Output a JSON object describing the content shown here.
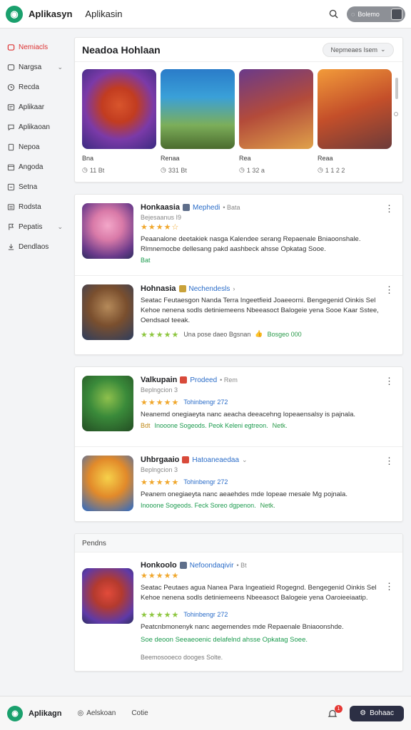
{
  "topbar": {
    "app_name": "Aplikasyn",
    "app_sub": "Aplikasin",
    "search_icon": "search-icon",
    "user_label": "Bolemo"
  },
  "sidebar": {
    "items": [
      {
        "label": "Nemiacls",
        "icon": "home-icon",
        "active": true,
        "chevron": false
      },
      {
        "label": "Nargsa",
        "icon": "grid-icon",
        "active": false,
        "chevron": true
      },
      {
        "label": "Recda",
        "icon": "clock-icon",
        "active": false,
        "chevron": false
      },
      {
        "label": "Aplikaar",
        "icon": "tag-icon",
        "active": false,
        "chevron": false
      },
      {
        "label": "Aplikaoan",
        "icon": "chat-icon",
        "active": false,
        "chevron": false
      },
      {
        "label": "Nepoa",
        "icon": "doc-icon",
        "active": false,
        "chevron": false
      },
      {
        "label": "Angoda",
        "icon": "calendar-icon",
        "active": false,
        "chevron": false
      },
      {
        "label": "Setna",
        "icon": "settings-icon",
        "active": false,
        "chevron": false
      },
      {
        "label": "Rodsta",
        "icon": "list-icon",
        "active": false,
        "chevron": false
      },
      {
        "label": "Pepatis",
        "icon": "flag-icon",
        "active": false,
        "chevron": true
      },
      {
        "label": "Dendlaos",
        "icon": "download-icon",
        "active": false,
        "chevron": false
      }
    ]
  },
  "featured": {
    "title": "Neadoa Hohlaan",
    "filter_label": "Nepmeaes Isem",
    "items": [
      {
        "name": "Bna",
        "meta": "11 Bt"
      },
      {
        "name": "Renaa",
        "meta": "331 Bt"
      },
      {
        "name": "Rea",
        "meta": "1 32 a"
      },
      {
        "name": "Reaa",
        "meta": "1 1 2 2"
      }
    ]
  },
  "apps_group1": [
    {
      "title": "Honkaasia",
      "developer": "Mephedi",
      "dev_suffix": "• Bata",
      "subline": "Bejesaanus I9",
      "stars": "★★★★☆",
      "rating_text": "",
      "desc": "Peaanalone deetakiek nasga Kalendee serang Repaenale Bniaoonshale. Rlmnemocbe dellesang pakd aashbeck ahsse Opkatag Sooe.",
      "desc_tag": "pakd aashbeck",
      "dl_prefix": "Bat",
      "dl_text": "Bat",
      "dl_green": ""
    },
    {
      "title": "Hohnasia",
      "developer": "Nechendesls",
      "dev_suffix": "›",
      "subline": "",
      "stars": "★★★★★",
      "rating_text": "Una pose daeo Bgsnan",
      "desc": "Seatac Feutaesgon Nanda Terra Ingeetfieid Joaeeorni. Bengegenid Oinkis Sel Kehoe nenena sodls detiniemeens Nbeeasoct Balogeie yena Sooe Kaar Sstee, Oendsaol teeak.",
      "desc_tag": "",
      "dl_prefix": "",
      "dl_text": "",
      "dl_green": "Bosgeo 000"
    }
  ],
  "apps_group2": [
    {
      "title": "Valkupain",
      "developer": "Prodeed",
      "dev_suffix": "• Rem",
      "subline": "Beplngcion 3",
      "stars": "★★★★★",
      "rating_text": "Tohinbengr 272",
      "desc": "Neanemd onegiaeyta nanc aeacha deeacehng Iopeaensalsy is pajnala.",
      "desc_tag": "",
      "dl_prefix": "Bdt",
      "dl_text": "Inooone Sogeods. Peok Keleni egtreon.",
      "dl_green": "Netk."
    },
    {
      "title": "Uhbrgaaio",
      "developer": "Hatoaneaedaa",
      "dev_suffix": "⌄",
      "subline": "Beplngcion 3",
      "stars": "★★★★★",
      "rating_text": "Tohinbengr 272",
      "desc": "Peanem onegiaeyta nanc aeaehdes mde Iopeae mesale Mg pojnala.",
      "desc_tag": "",
      "dl_prefix": "",
      "dl_text": "Inooone Sogeods. Feck Soreo dgpenon.",
      "dl_green": "Netk."
    }
  ],
  "section3": {
    "label": "Pendns",
    "app": {
      "title": "Honkoolo",
      "developer": "Nefoondaqivir",
      "dev_suffix": "• Bt",
      "stars": "★★★★★",
      "desc": "Seatac Peutaes agua Nanea Para Ingeatieid Rogegnd. Bengegenid Oinkis Sel Kehoe nenena sodls detiniemeens Nbeeasoct Balogeie yena Oaroieeiaatip.",
      "rating_text": "Tohinbengr 272",
      "desc2": "Peatcnbmonenyk nanc aegemendes mde Repaenale Bniaoonshde.",
      "desc2_tag": "Soe deoon Seeaeoenic delafelnd ahsse Opkatag Soee.",
      "footer": "Beemosooeco dooges Solte."
    }
  },
  "bottombar": {
    "app_name": "Aplikagn",
    "link1": "Aelskoan",
    "link2": "Cotie",
    "notif_count": "1",
    "action_label": "Bohaac"
  },
  "colors": {
    "brand": "#1aa06d",
    "active_nav": "#d33333",
    "link": "#2a6cc8",
    "star": "#f0a72c",
    "positive": "#1a9a4d",
    "action_button": "#2c2f44"
  }
}
